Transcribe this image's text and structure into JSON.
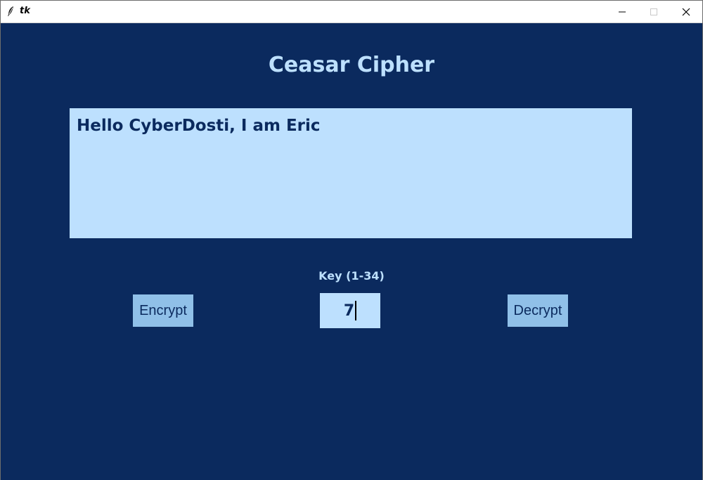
{
  "window": {
    "title": "tk",
    "icon": "feather-icon",
    "controls": [
      "minimize-icon",
      "maximize-icon",
      "close-icon"
    ]
  },
  "app": {
    "heading": "Ceasar Cipher",
    "message_text": "Hello CyberDosti, I am Eric",
    "key_label": "Key (1-34)",
    "key_value": "7",
    "encrypt_label": "Encrypt",
    "decrypt_label": "Decrypt"
  },
  "colors": {
    "background": "#0b2a5e",
    "light_blue": "#bde0fe",
    "button_blue": "#90c0e8"
  }
}
